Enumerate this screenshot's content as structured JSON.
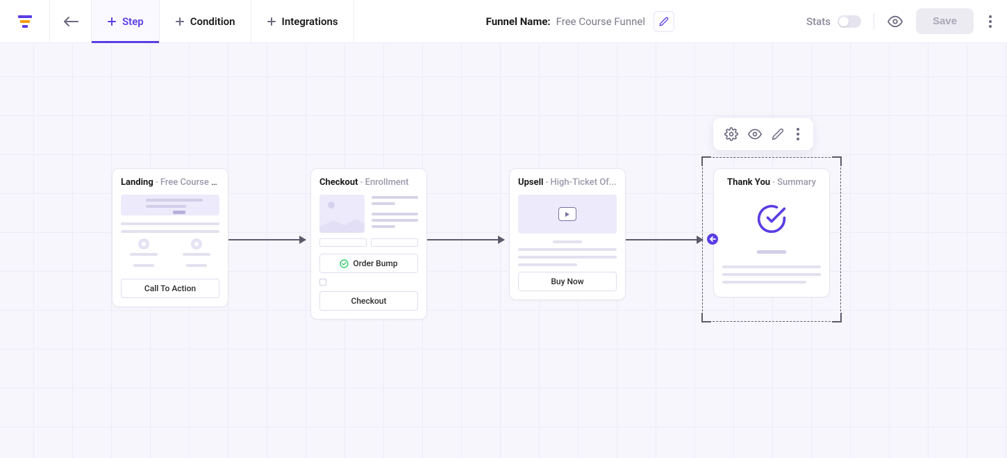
{
  "header": {
    "tabs": {
      "step": "Step",
      "condition": "Condition",
      "integrations": "Integrations"
    },
    "funnel_label": "Funnel Name:",
    "funnel_value": "Free Course Funnel",
    "stats_label": "Stats",
    "save_label": "Save"
  },
  "nodes": {
    "landing": {
      "title": "Landing",
      "subtitle": "Free Course Of...",
      "cta": "Call To Action"
    },
    "checkout": {
      "title": "Checkout",
      "subtitle": "Enrollment",
      "order_bump": "Order Bump",
      "cta": "Checkout"
    },
    "upsell": {
      "title": "Upsell",
      "subtitle": "High-Ticket Of...",
      "cta": "Buy Now"
    },
    "thankyou": {
      "title": "Thank You",
      "subtitle": "Summary"
    }
  },
  "colors": {
    "accent": "#5b3de3"
  }
}
